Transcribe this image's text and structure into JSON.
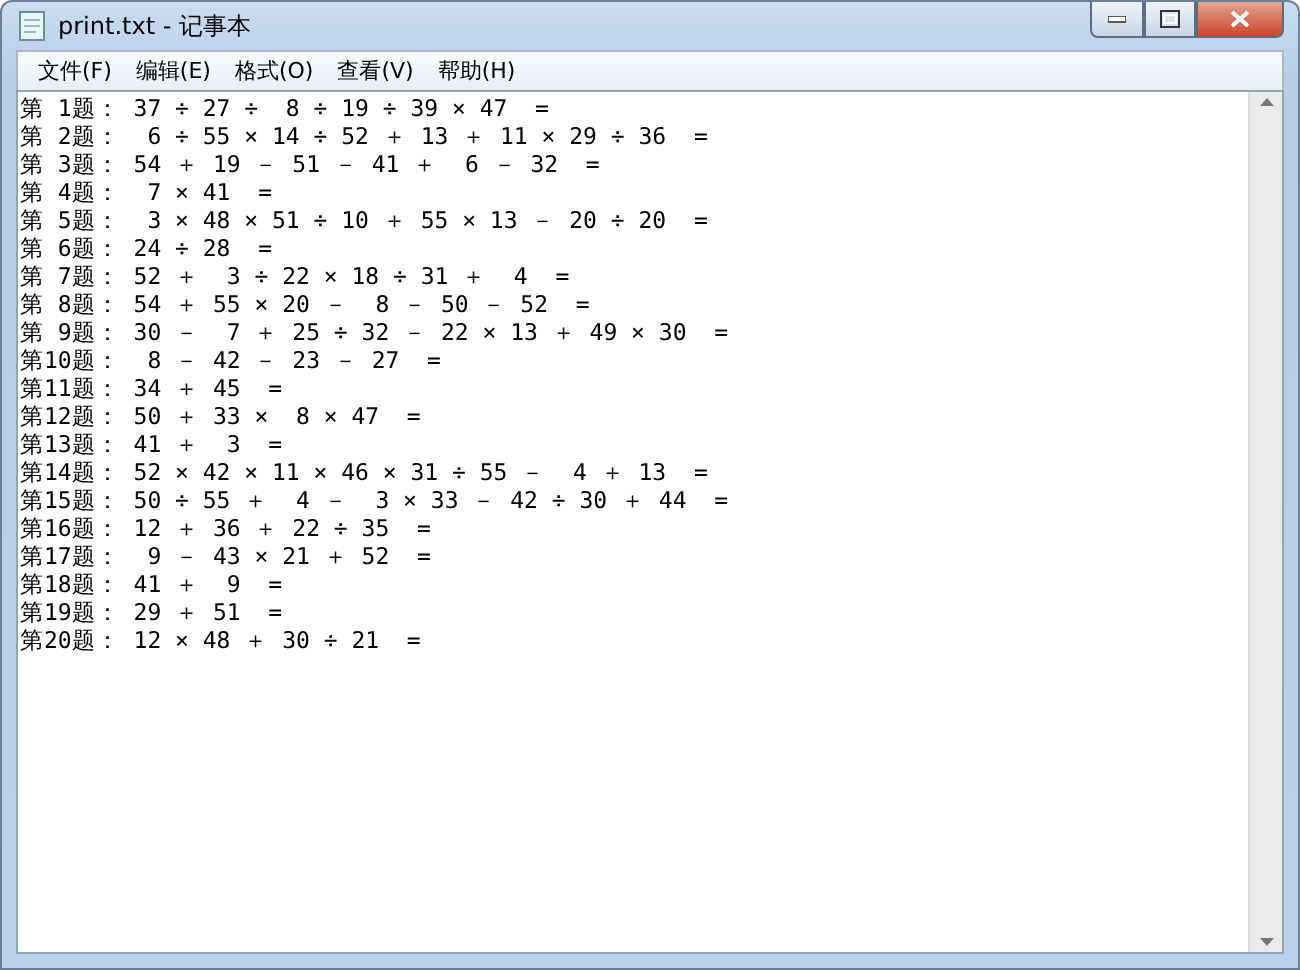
{
  "window": {
    "title": "print.txt - 记事本"
  },
  "menu": [
    "文件(F)",
    "编辑(E)",
    "格式(O)",
    "查看(V)",
    "帮助(H)"
  ],
  "document": {
    "lines": [
      "第 1题： 37 ÷ 27 ÷  8 ÷ 19 ÷ 39 × 47  =",
      "第 2题：  6 ÷ 55 × 14 ÷ 52 ＋ 13 ＋ 11 × 29 ÷ 36  =",
      "第 3题： 54 ＋ 19 － 51 － 41 ＋  6 － 32  =",
      "第 4题：  7 × 41  =",
      "第 5题：  3 × 48 × 51 ÷ 10 ＋ 55 × 13 － 20 ÷ 20  =",
      "第 6题： 24 ÷ 28  =",
      "第 7题： 52 ＋  3 ÷ 22 × 18 ÷ 31 ＋  4  =",
      "第 8题： 54 ＋ 55 × 20 －  8 － 50 － 52  =",
      "第 9题： 30 －  7 ＋ 25 ÷ 32 － 22 × 13 ＋ 49 × 30  =",
      "第10题：  8 － 42 － 23 － 27  =",
      "第11题： 34 ＋ 45  =",
      "第12题： 50 ＋ 33 ×  8 × 47  =",
      "第13题： 41 ＋  3  =",
      "第14题： 52 × 42 × 11 × 46 × 31 ÷ 55 －  4 ＋ 13  =",
      "第15题： 50 ÷ 55 ＋  4 －  3 × 33 － 42 ÷ 30 ＋ 44  =",
      "第16题： 12 ＋ 36 ＋ 22 ÷ 35  =",
      "第17题：  9 － 43 × 21 ＋ 52  =",
      "第18题： 41 ＋  9  =",
      "第19题： 29 ＋ 51  =",
      "第20题： 12 × 48 ＋ 30 ÷ 21  ="
    ]
  }
}
